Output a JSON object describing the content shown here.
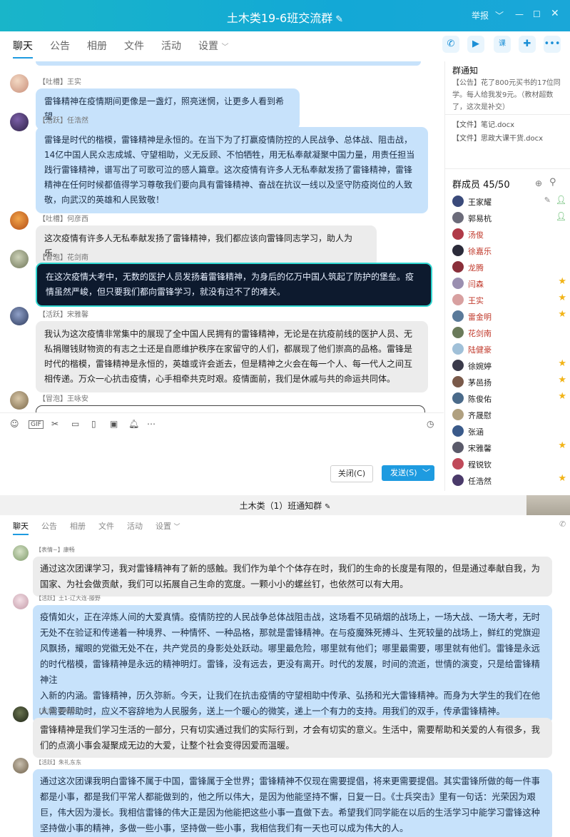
{
  "window1": {
    "title": "土木类19-6班交流群",
    "controls": {
      "report": "举报"
    },
    "tabs": [
      "聊天",
      "公告",
      "相册",
      "文件",
      "活动",
      "设置"
    ],
    "messages": [
      {
        "tag": "【吐槽】",
        "name": "王实",
        "style": "blue",
        "text": "雷锋精神在疫情期间更像是一盏灯，照亮迷惘，让更多人看到希望"
      },
      {
        "tag": "【活跃】",
        "name": "任浩然",
        "style": "blue",
        "lines": [
          "雷锋是时代的楷模，雷锋精神是永恒的。在当下为了打赢疫情防控的人民战争、总体战、阻击战，",
          "14亿中国人民众志成城、守望相助，义无反顾、不怕牺牲，用无私奉献凝聚中国力量，用责任担当",
          "践行雷锋精神，谱写出了可歌可泣的感人篇章。这次疫情有许多人无私奉献发扬了雷锋精神，雷锋",
          "精神在任何时候都值得学习尊敬我们要向具有雷锋精神、奋战在抗议一线以及坚守防疫岗位的人致",
          "敬，向武汉的英雄和人民致敬！"
        ]
      },
      {
        "tag": "【吐槽】",
        "name": "何彦西",
        "style": "gray",
        "text": "这次疫情有许多人无私奉献发扬了雷锋精神，我们都应该向雷锋同志学习，助人为乐。"
      },
      {
        "tag": "【冒泡】",
        "name": "花剑南",
        "style": "dark",
        "lines": [
          "在这次疫情大考中，无数的医护人员发扬着雷锋精神，为身后的亿万中国人筑起了防护的堡垒。疫",
          "情虽然严峻，但只要我们都向雷锋学习，就没有过不了的难关。"
        ]
      },
      {
        "tag": "【活跃】",
        "name": "宋雅馨",
        "style": "gray",
        "lines": [
          "我认为这次疫情非常集中的展现了全中国人民拥有的雷锋精神，无论是在抗疫前线的医护人员、无",
          "私捐赠钱财物资的有志之士还是自愿维护秩序在家留守的人们，都展现了他们崇高的品格。雷锋是",
          "时代的楷模，雷锋精神是永恒的，英雄或许会逝去，但是精神之火会在每一个人、每一代人之间互",
          "相传递。万众一心抗击疫情，心手相牵共克时艰。疫情面前，我们是休戚与共的命运共同体。"
        ]
      },
      {
        "tag": "【冒泡】",
        "name": "王咏安",
        "style": "gray",
        "text": ""
      }
    ],
    "notice": {
      "heading": "群通知",
      "text": "【公告】花了800元买书的17位同学。每人给我发9元。（教材超数了，这次是补交）",
      "files": [
        "【文件】笔记.docx",
        "【文件】思政大课干货.docx"
      ]
    },
    "members_heading": "群成员 45/50",
    "members": [
      {
        "name": "王家耀",
        "color": "#222222",
        "badge": "admin",
        "avatar": "#3a4a7a"
      },
      {
        "name": "郭易杭",
        "color": "#222222",
        "badge": "admin",
        "avatar": "#6b6b7a"
      },
      {
        "name": "汤俊",
        "color": "#c0392b",
        "badge": "",
        "avatar": "#b03a48"
      },
      {
        "name": "徐嘉乐",
        "color": "#c0392b",
        "badge": "",
        "avatar": "#2b2b3a"
      },
      {
        "name": "龙腾",
        "color": "#c0392b",
        "badge": "",
        "avatar": "#8a2f3a"
      },
      {
        "name": "闫森",
        "color": "#c0392b",
        "badge": "star",
        "avatar": "#9a8fb0"
      },
      {
        "name": "王实",
        "color": "#c0392b",
        "badge": "star",
        "avatar": "#d8a0a0"
      },
      {
        "name": "雷金明",
        "color": "#c0392b",
        "badge": "star",
        "avatar": "#5a7a9a"
      },
      {
        "name": "花剑南",
        "color": "#c0392b",
        "badge": "",
        "avatar": "#6a7a5a"
      },
      {
        "name": "陆健豪",
        "color": "#c0392b",
        "badge": "",
        "avatar": "#a0c0d8"
      },
      {
        "name": "徐婉婷",
        "color": "#222222",
        "badge": "star",
        "avatar": "#3a3a4a"
      },
      {
        "name": "茅邑扬",
        "color": "#222222",
        "badge": "star",
        "avatar": "#7a5a4a"
      },
      {
        "name": "陈俊佑",
        "color": "#222222",
        "badge": "star",
        "avatar": "#4a6a8a"
      },
      {
        "name": "齐晟慰",
        "color": "#222222",
        "badge": "",
        "avatar": "#b0a080"
      },
      {
        "name": "张涵",
        "color": "#222222",
        "badge": "",
        "avatar": "#3a5a8a"
      },
      {
        "name": "宋雅馨",
        "color": "#222222",
        "badge": "star",
        "avatar": "#5a5a6a"
      },
      {
        "name": "程锐钦",
        "color": "#222222",
        "badge": "",
        "avatar": "#c04a5a"
      },
      {
        "name": "任浩然",
        "color": "#222222",
        "badge": "star",
        "avatar": "#4a3a6a"
      }
    ],
    "buttons": {
      "close": "关闭(C)",
      "send": "发送(S)"
    }
  },
  "window2": {
    "title": "土木类（1）班通知群",
    "tabs": [
      "聊天",
      "公告",
      "相册",
      "文件",
      "活动",
      "设置"
    ],
    "messages": [
      {
        "tag": "【表情~】",
        "name": "康畅",
        "style": "gray",
        "lines": [
          "通过这次团课学习，我对雷锋精神有了新的感触。我们作为单个个体存在时，我们的生命的长度是有限的，但是通过奉献自我，为",
          "国家、为社会做贡献，我们可以拓展自己生命的宽度。一颗小小的螺丝钉，也依然可以有大用。"
        ]
      },
      {
        "tag": "【活跃】",
        "name": "土1-辽大连-滕野",
        "style": "blue",
        "lines": [
          "疫情如火，正在淬炼人间的大爱真情。疫情防控的人民战争总体战阻击战，这场看不见硝烟的战场上，一场大战、一场大考，无时",
          "无处不在验证和传递着一种境界、一种情怀、一种品格，那就是雷锋精神。在与疫魔殊死搏斗、生死较量的战场上，鲜红的党旗迎",
          "风飘扬，耀眼的党徽无处不在，共产党员的身影处处跃动。哪里最危险，哪里就有他们；哪里最需要，哪里就有他们。雷锋是永远",
          "的时代楷模，雷锋精神是永远的精神明灯。雷锋，没有远去，更没有离开。时代的发展，时间的流逝，世情的演变，只是给雷锋精神注",
          "入新的内涵。雷锋精神，历久弥新。今天，让我们在抗击疫情的守望相助中传承、弘扬和光大雷锋精神。而身为大学生的我们在他",
          "人需要帮助时，应义不容辞地为人民服务，送上一个暖心的微笑，递上一个有力的支持。用我们的双手，传承雷锋精神。"
        ]
      },
      {
        "tag": "【冒泡】",
        "name": "朱晓辰",
        "style": "gray",
        "lines": [
          "雷锋精神是我们学习生活的一部分，只有切实通过我们的实际行到，才会有切实的意义。生活中，需要帮助和关爱的人有很多，我",
          "们的点滴小事会凝聚成无边的大爱，让整个社会变得因爱而温暖。"
        ]
      },
      {
        "tag": "【活跃】",
        "name": "朱礼东东",
        "style": "blue",
        "lines": [
          "通过这次团课我明白雷锋不属于中国，雷锋属于全世界；雷锋精神不仅现在需要提倡，将来更需要提倡。其实雷锋所做的每一件事",
          "都是小事，都是我们平常人都能做到的，他之所以伟大，是因为他能坚持不懈，日复一日。《士兵突击》里有一句话：光荣因为艰",
          "巨，伟大因为漫长。我相信雷锋的伟大正是因为他能把这些小事一直做下去。希望我们同学能在以后的生活学习中能学习雷锋这种",
          "坚持做小事的精神，多做一些小事，坚持做一些小事，我相信我们有一天也可以成为伟大的人。"
        ]
      }
    ]
  }
}
